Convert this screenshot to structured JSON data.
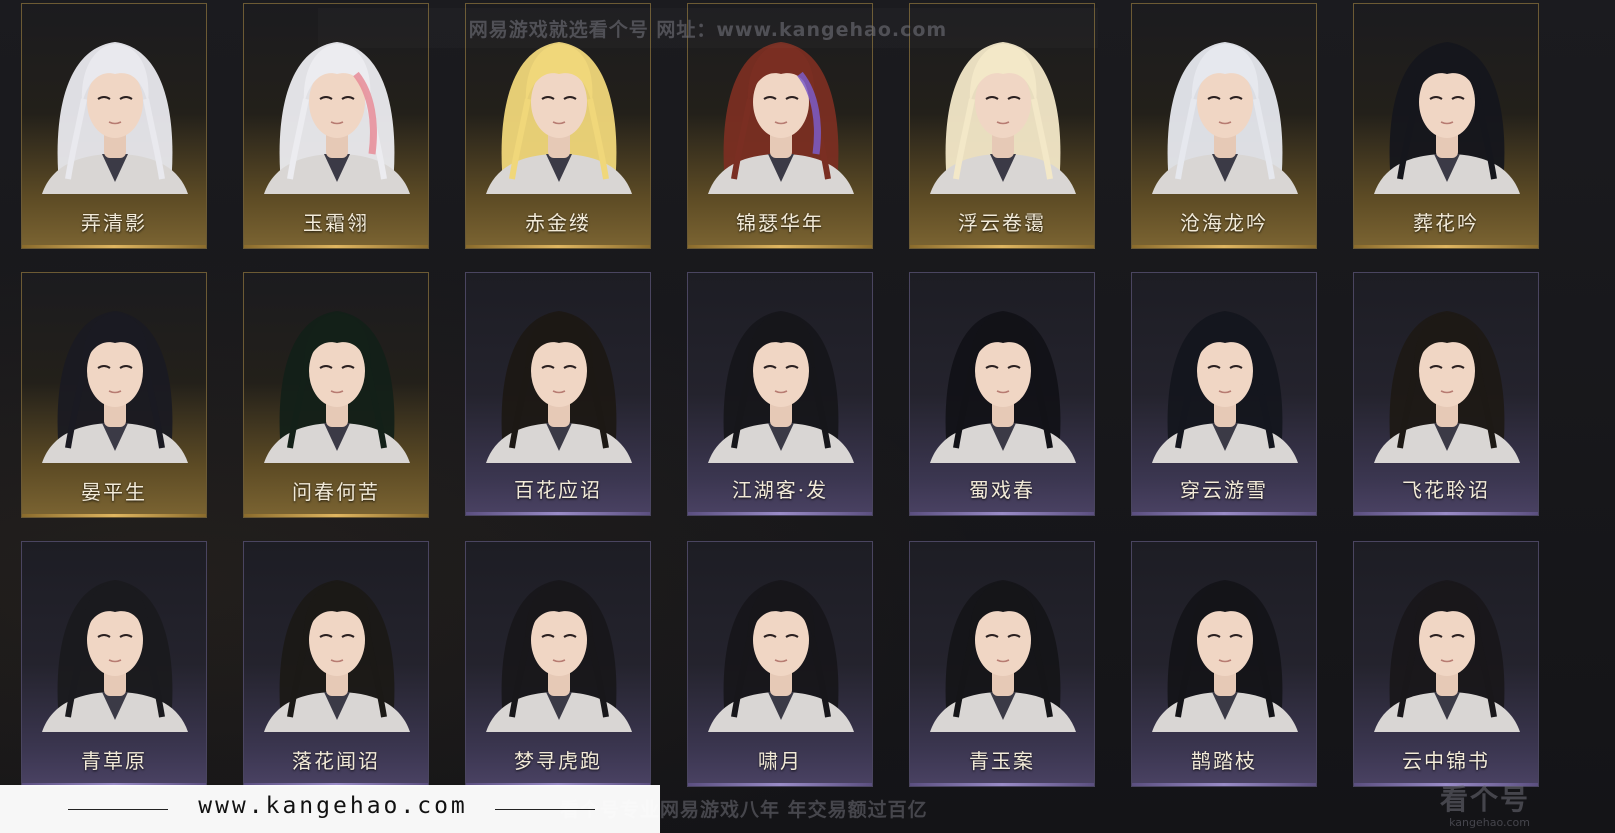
{
  "watermark": {
    "top_text": "网易游戏就选看个号  网址：www.kangehao.com",
    "bottom_text": "看个号专业网易游戏八年  年交易额过百亿",
    "logo_text": "看个号",
    "logo_sub": "kangehao.com"
  },
  "banner": {
    "url": "www.kangehao.com"
  },
  "colors": {
    "gold_tier": "#7b6432",
    "purple_tier": "#4a4263",
    "name_text": "#f2ead8"
  },
  "hairstyles": [
    {
      "name": "弄清影",
      "tier": "gold",
      "hair": "#e9e9ee"
    },
    {
      "name": "玉霜翎",
      "tier": "gold",
      "hair": "#ececf0",
      "accent": "#e88c98"
    },
    {
      "name": "赤金缕",
      "tier": "gold",
      "hair": "#f0d77a"
    },
    {
      "name": "锦瑟华年",
      "tier": "gold",
      "hair": "#7a2e22",
      "accent": "#7b5cc8"
    },
    {
      "name": "浮云卷霭",
      "tier": "gold",
      "hair": "#f3e8c8"
    },
    {
      "name": "沧海龙吟",
      "tier": "gold",
      "hair": "#e6e8ee"
    },
    {
      "name": "葬花吟",
      "tier": "gold",
      "hair": "#15161c"
    },
    {
      "name": "晏平生",
      "tier": "gold",
      "hair": "#1a1a22"
    },
    {
      "name": "问春何苦",
      "tier": "gold",
      "hair": "#132018"
    },
    {
      "name": "百花应诏",
      "tier": "purple",
      "hair": "#1c1814"
    },
    {
      "name": "江湖客·发",
      "tier": "purple",
      "hair": "#16161a"
    },
    {
      "name": "蜀戏春",
      "tier": "purple",
      "hair": "#121217"
    },
    {
      "name": "穿云游雪",
      "tier": "purple",
      "hair": "#14161e"
    },
    {
      "name": "飞花聆诏",
      "tier": "purple",
      "hair": "#1d1915"
    },
    {
      "name": "青草原",
      "tier": "purple",
      "hair": "#1a1a1e"
    },
    {
      "name": "落花闻诏",
      "tier": "purple",
      "hair": "#1b1916"
    },
    {
      "name": "梦寻虎跑",
      "tier": "purple",
      "hair": "#18171a"
    },
    {
      "name": "啸月",
      "tier": "purple",
      "hair": "#17161a"
    },
    {
      "name": "青玉案",
      "tier": "purple",
      "hair": "#151518"
    },
    {
      "name": "鹊踏枝",
      "tier": "purple",
      "hair": "#141418"
    },
    {
      "name": "云中锦书",
      "tier": "purple",
      "hair": "#19171a"
    }
  ]
}
